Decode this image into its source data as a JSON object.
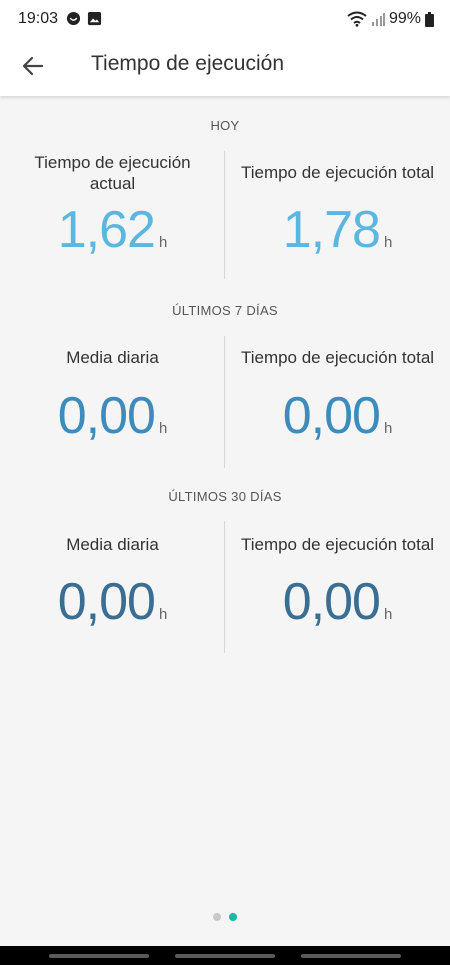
{
  "status": {
    "time": "19:03",
    "battery": "99%"
  },
  "header": {
    "title": "Tiempo de ejecución"
  },
  "colors": {
    "today": "#5bb6e0",
    "week": "#3d8cbb",
    "month": "#3a6e93",
    "dot_active": "#1ab7a9",
    "dot_inactive": "#c8c8c8"
  },
  "sections": [
    {
      "title": "HOY",
      "left": {
        "label": "Tiempo de ejecución actual",
        "value": "1,62",
        "unit": "h"
      },
      "right": {
        "label": "Tiempo de ejecución total",
        "value": "1,78",
        "unit": "h"
      }
    },
    {
      "title": "ÚLTIMOS 7 DÍAS",
      "left": {
        "label": "Media diaria",
        "value": "0,00",
        "unit": "h"
      },
      "right": {
        "label": "Tiempo de ejecución total",
        "value": "0,00",
        "unit": "h"
      }
    },
    {
      "title": "ÚLTIMOS 30 DÍAS",
      "left": {
        "label": "Media diaria",
        "value": "0,00",
        "unit": "h"
      },
      "right": {
        "label": "Tiempo de ejecución total",
        "value": "0,00",
        "unit": "h"
      }
    }
  ],
  "pager": {
    "page": 2,
    "count": 2
  }
}
